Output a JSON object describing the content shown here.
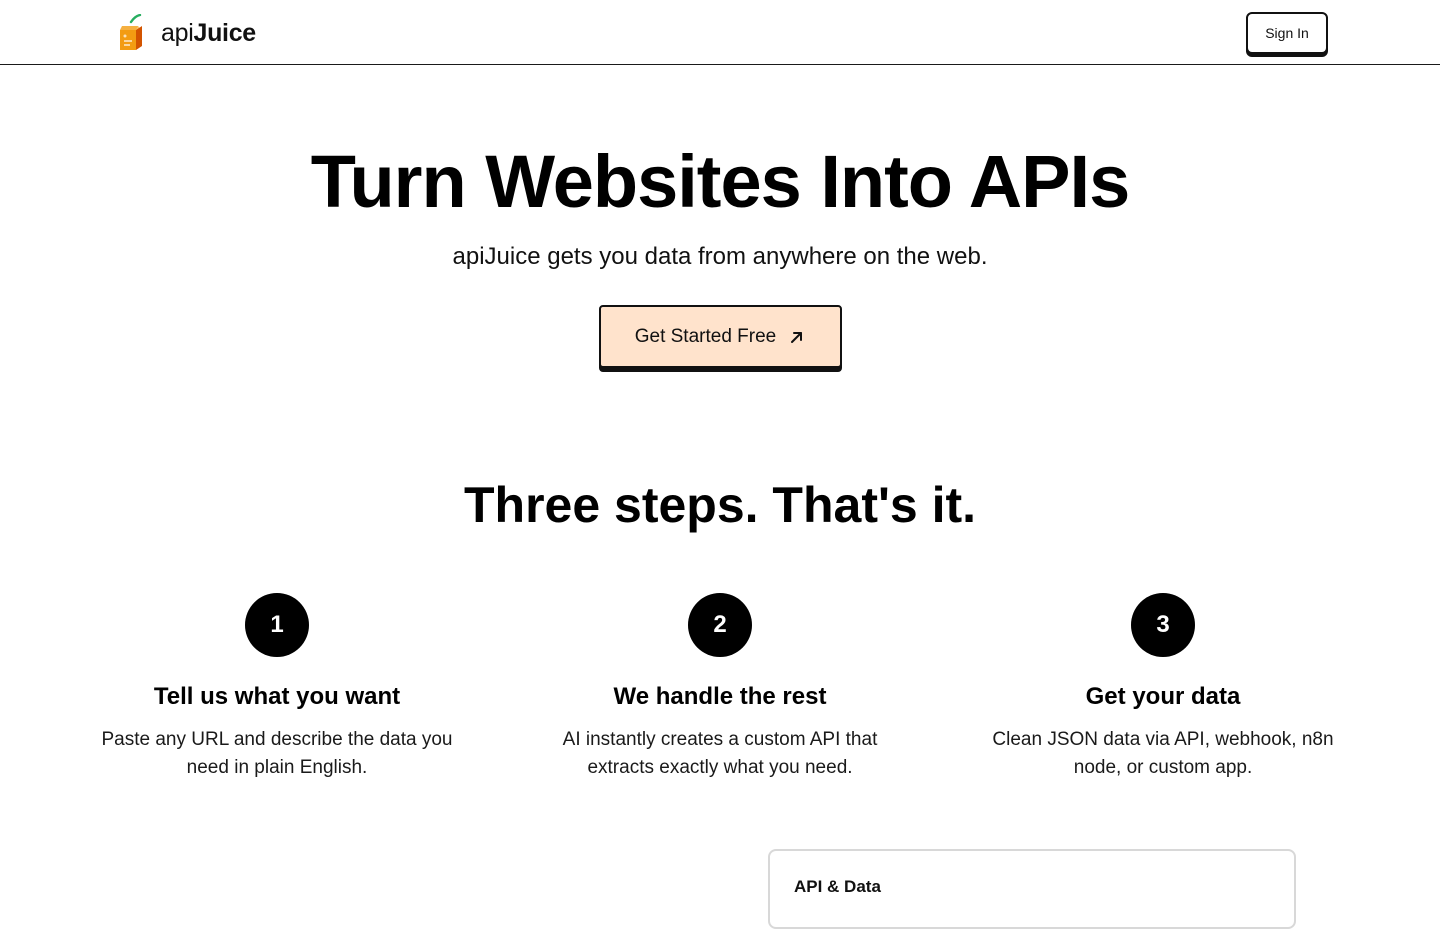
{
  "header": {
    "brand": {
      "name_light": "api",
      "name_bold": "Juice",
      "logo_icon": "juice-box-icon",
      "logo_colors": {
        "body": "#f39c12",
        "side": "#e67e22",
        "leaf": "#27ae60"
      }
    },
    "signin_label": "Sign In"
  },
  "hero": {
    "title": "Turn Websites Into APIs",
    "subtitle": "apiJuice gets you data from anywhere on the web.",
    "cta_label": "Get Started Free",
    "cta_icon": "arrow-up-right-icon",
    "cta_background": "#ffe3cc"
  },
  "steps": {
    "title": "Three steps. That's it.",
    "items": [
      {
        "number": "1",
        "heading": "Tell us what you want",
        "description": "Paste any URL and describe the data you need in plain English."
      },
      {
        "number": "2",
        "heading": "We handle the rest",
        "description": "AI instantly creates a custom API that extracts exactly what you need."
      },
      {
        "number": "3",
        "heading": "Get your data",
        "description": "Clean JSON data via API, webhook, n8n node, or custom app."
      }
    ]
  },
  "card": {
    "title": "API & Data"
  }
}
